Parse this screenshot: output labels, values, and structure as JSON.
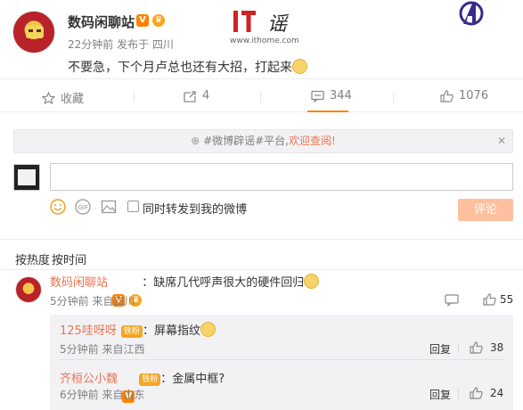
{
  "post": {
    "username": "数码闲聊站",
    "meta": "22分钟前 发布于 四川",
    "text": "不要急，下个月卢总也还有大招，打起来"
  },
  "watermark": {
    "url": "www.ithome.com"
  },
  "actions": {
    "favorite": "收藏",
    "repost_count": "4",
    "comment_count": "344",
    "like_count": "1076"
  },
  "notice": {
    "prefix": "#微博辟谣#平台,",
    "highlight": "欢迎查阅!",
    "close": "✕"
  },
  "composer": {
    "input_value": "",
    "repost_label": "同时转发到我的微博",
    "submit_label": "评论"
  },
  "sort": {
    "hot": "按热度",
    "time": "按时间"
  },
  "comments": [
    {
      "username": "数码闲聊站",
      "text": "：缺席几代呼声很大的硬件回归",
      "meta": "5分钟前 来自四川",
      "likes": "55"
    }
  ],
  "replies": [
    {
      "username": "125哇呀呀",
      "badge": "铁粉",
      "text": "：屏幕指纹",
      "meta": "5分钟前 来自江西",
      "reply_label": "回复",
      "likes": "38"
    },
    {
      "username": "齐桓公小魏",
      "badge": "铁粉",
      "text": "：金属中框?",
      "meta": "6分钟前 来自山东",
      "reply_label": "回复",
      "likes": "24"
    }
  ],
  "colors": {
    "accent": "#eb7350",
    "tab_active": "#ff8200",
    "submit_disabled": "#ffc09f"
  }
}
